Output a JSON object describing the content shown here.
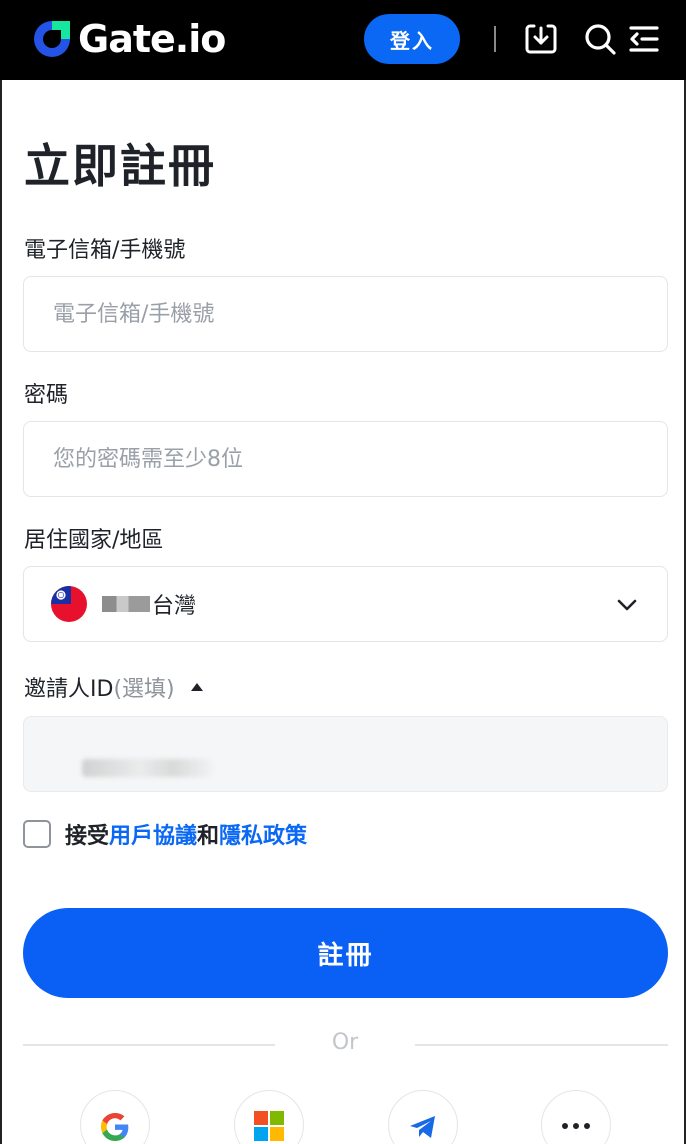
{
  "header": {
    "logo_text": "Gate.io",
    "login_label": "登入",
    "icons": [
      "download-icon",
      "search-icon",
      "menu-icon"
    ]
  },
  "page": {
    "title": "立即註冊"
  },
  "form": {
    "account": {
      "label": "電子信箱/手機號",
      "placeholder": "電子信箱/手機號",
      "value": ""
    },
    "password": {
      "label": "密碼",
      "placeholder": "您的密碼需至少8位",
      "value": ""
    },
    "country": {
      "label": "居住國家/地區",
      "value": "台灣",
      "flag_icon": "taiwan-flag-icon"
    },
    "invite": {
      "label": "邀請人ID",
      "optional": "(選填)"
    },
    "agree": {
      "prefix": "接受",
      "terms": "用戶協議",
      "and": "和",
      "privacy": "隱私政策"
    },
    "submit_label": "註冊"
  },
  "divider": {
    "text": "Or"
  },
  "social": [
    "google-icon",
    "microsoft-icon",
    "telegram-icon",
    "more-icon"
  ],
  "colors": {
    "brand_blue": "#0a68f4",
    "button_blue": "#0a5ff4",
    "header_bg": "#000000"
  }
}
